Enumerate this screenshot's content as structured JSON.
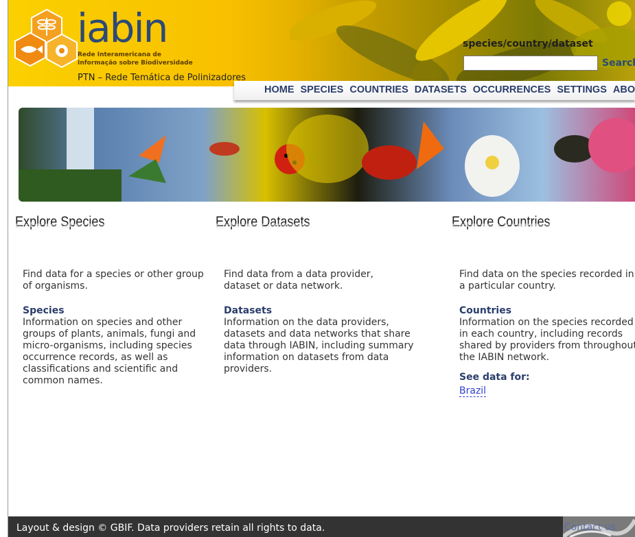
{
  "header": {
    "logo_text": "iabin",
    "logo_subtitle_1": "Rede Interamericana de",
    "logo_subtitle_2": "Informação sobre Biodiversidade",
    "ptn_text": "PTN – Rede Temática de Polinizadores",
    "search_label": "species/country/dataset",
    "search_button": "Search",
    "search_value": ""
  },
  "nav": {
    "items": [
      {
        "label": "HOME"
      },
      {
        "label": "SPECIES"
      },
      {
        "label": "COUNTRIES"
      },
      {
        "label": "DATASETS"
      },
      {
        "label": "OCCURRENCES"
      },
      {
        "label": "SETTINGS"
      },
      {
        "label": "ABOUT"
      }
    ]
  },
  "columns": [
    {
      "title": "Explore Species",
      "intro": "Find data for a species or other group of organisms.",
      "subhead": "Species",
      "body": "Information on species and other groups of plants, animals, fungi and micro-organisms, including species occurrence records, as well as classifications and scientific and common names."
    },
    {
      "title": "Explore Datasets",
      "intro": "Find data from a data provider, dataset or data network.",
      "subhead": "Datasets",
      "body": "Information on the data providers, datasets and data networks that share data through IABIN, including summary information on datasets from data providers."
    },
    {
      "title": "Explore Countries",
      "intro": "Find data on the species recorded in a particular country.",
      "subhead": "Countries",
      "body": "Information on the species recorded in each country, including records shared by providers from throughout the IABIN network.",
      "see_data_label": "See data for:",
      "country_link": "Brazil"
    }
  ],
  "footer": {
    "text": "Layout & design © GBIF. Data providers retain all rights to data.",
    "contact": "Contact us"
  },
  "colors": {
    "header_yellow": "#fbd000",
    "nav_text": "#2a3d6b",
    "logo_blue": "#2c4a76",
    "link_blue": "#2f3fd0",
    "footer_bg": "#333333"
  }
}
